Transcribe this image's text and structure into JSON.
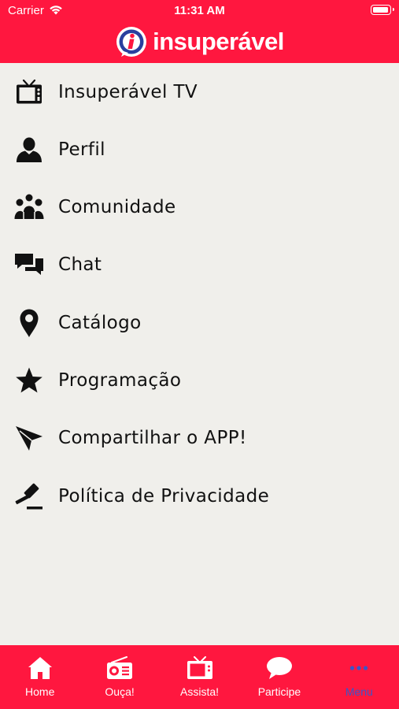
{
  "status_bar": {
    "carrier": "Carrier",
    "time": "11:31 AM"
  },
  "header": {
    "brand": "insuperável",
    "background_color": "#ff173f"
  },
  "menu": {
    "items": [
      {
        "label": "Insuperável TV",
        "icon": "tv-icon"
      },
      {
        "label": "Perfil",
        "icon": "user-icon"
      },
      {
        "label": "Comunidade",
        "icon": "community-icon"
      },
      {
        "label": "Chat",
        "icon": "chat-icon"
      },
      {
        "label": "Catálogo",
        "icon": "map-pin-icon"
      },
      {
        "label": "Programação",
        "icon": "star-icon"
      },
      {
        "label": "Compartilhar o APP!",
        "icon": "paper-plane-icon"
      },
      {
        "label": "Política de Privacidade",
        "icon": "gavel-icon"
      }
    ]
  },
  "tab_bar": {
    "active_color": "#3b55c8",
    "tabs": [
      {
        "label": "Home",
        "icon": "home-icon"
      },
      {
        "label": "Ouça!",
        "icon": "radio-icon"
      },
      {
        "label": "Assista!",
        "icon": "tv-icon"
      },
      {
        "label": "Participe",
        "icon": "speech-bubble-icon"
      },
      {
        "label": "Menu",
        "icon": "more-dots-icon",
        "active": true
      }
    ]
  }
}
